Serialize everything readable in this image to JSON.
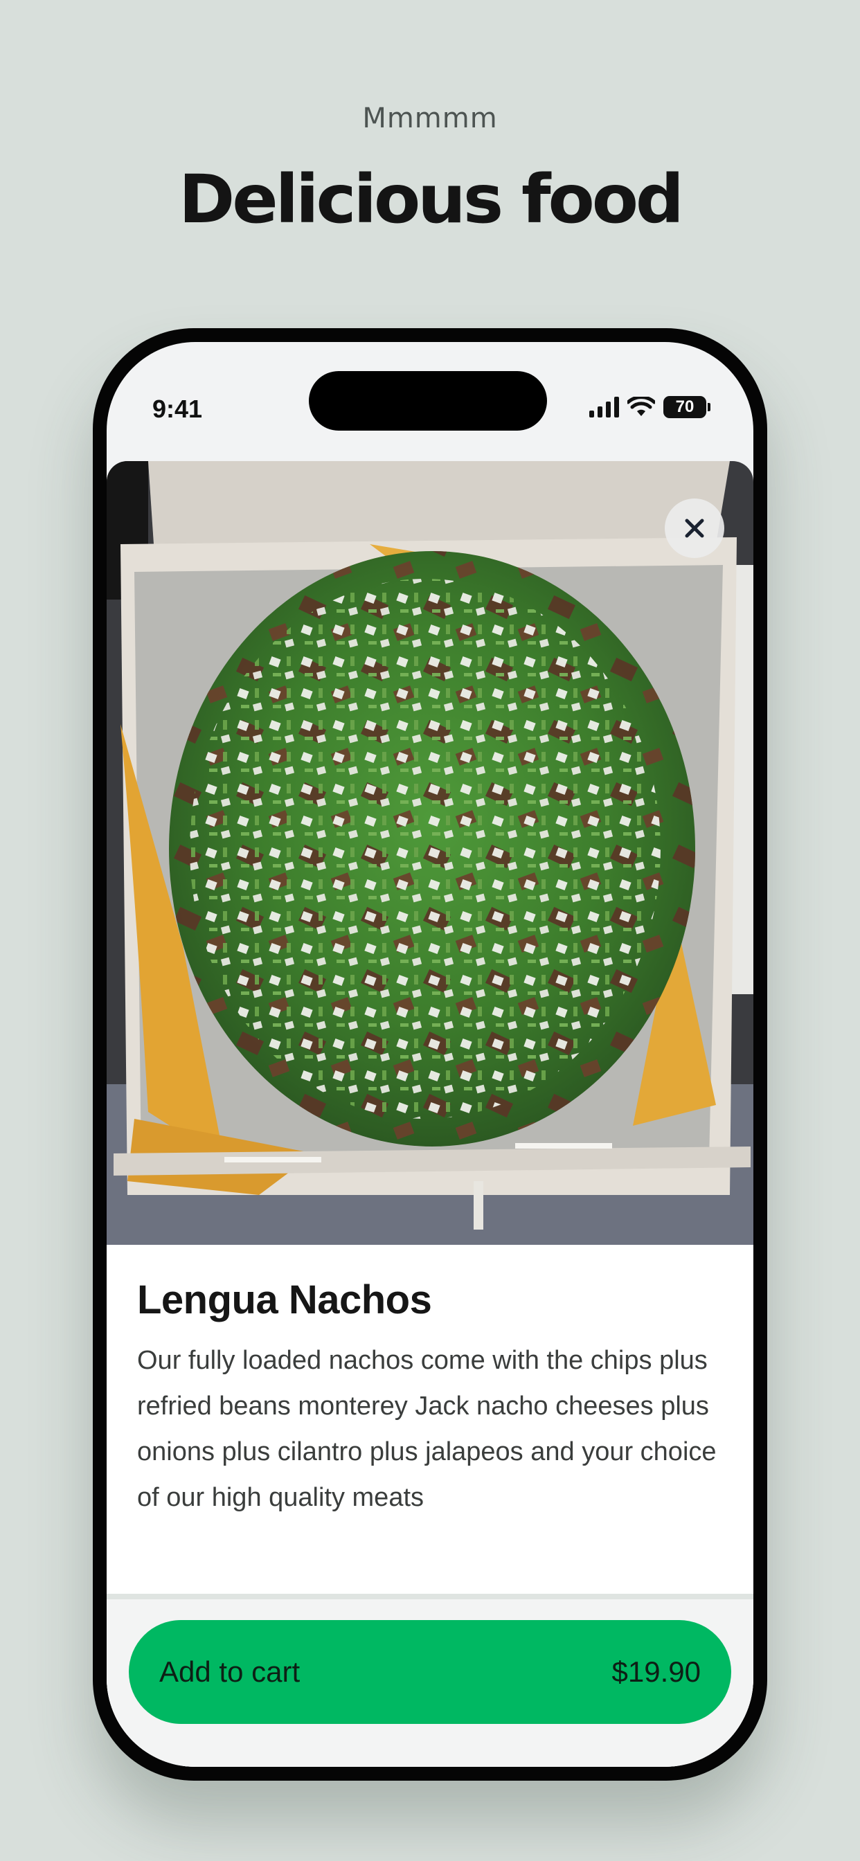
{
  "page": {
    "kicker": "Mmmmm",
    "headline": "Delicious food"
  },
  "status_bar": {
    "time": "9:41",
    "battery": "70"
  },
  "item": {
    "title": "Lengua Nachos",
    "description": "Our fully loaded nachos come with the chips plus refried beans monterey Jack nacho cheeses plus onions plus cilantro plus jalapeos and your choice of our high quality meats",
    "photo_icon": "food-photo"
  },
  "cart": {
    "label": "Add to cart",
    "price": "$19.90"
  },
  "colors": {
    "background": "#d8dfdb",
    "accent": "#00b862"
  }
}
